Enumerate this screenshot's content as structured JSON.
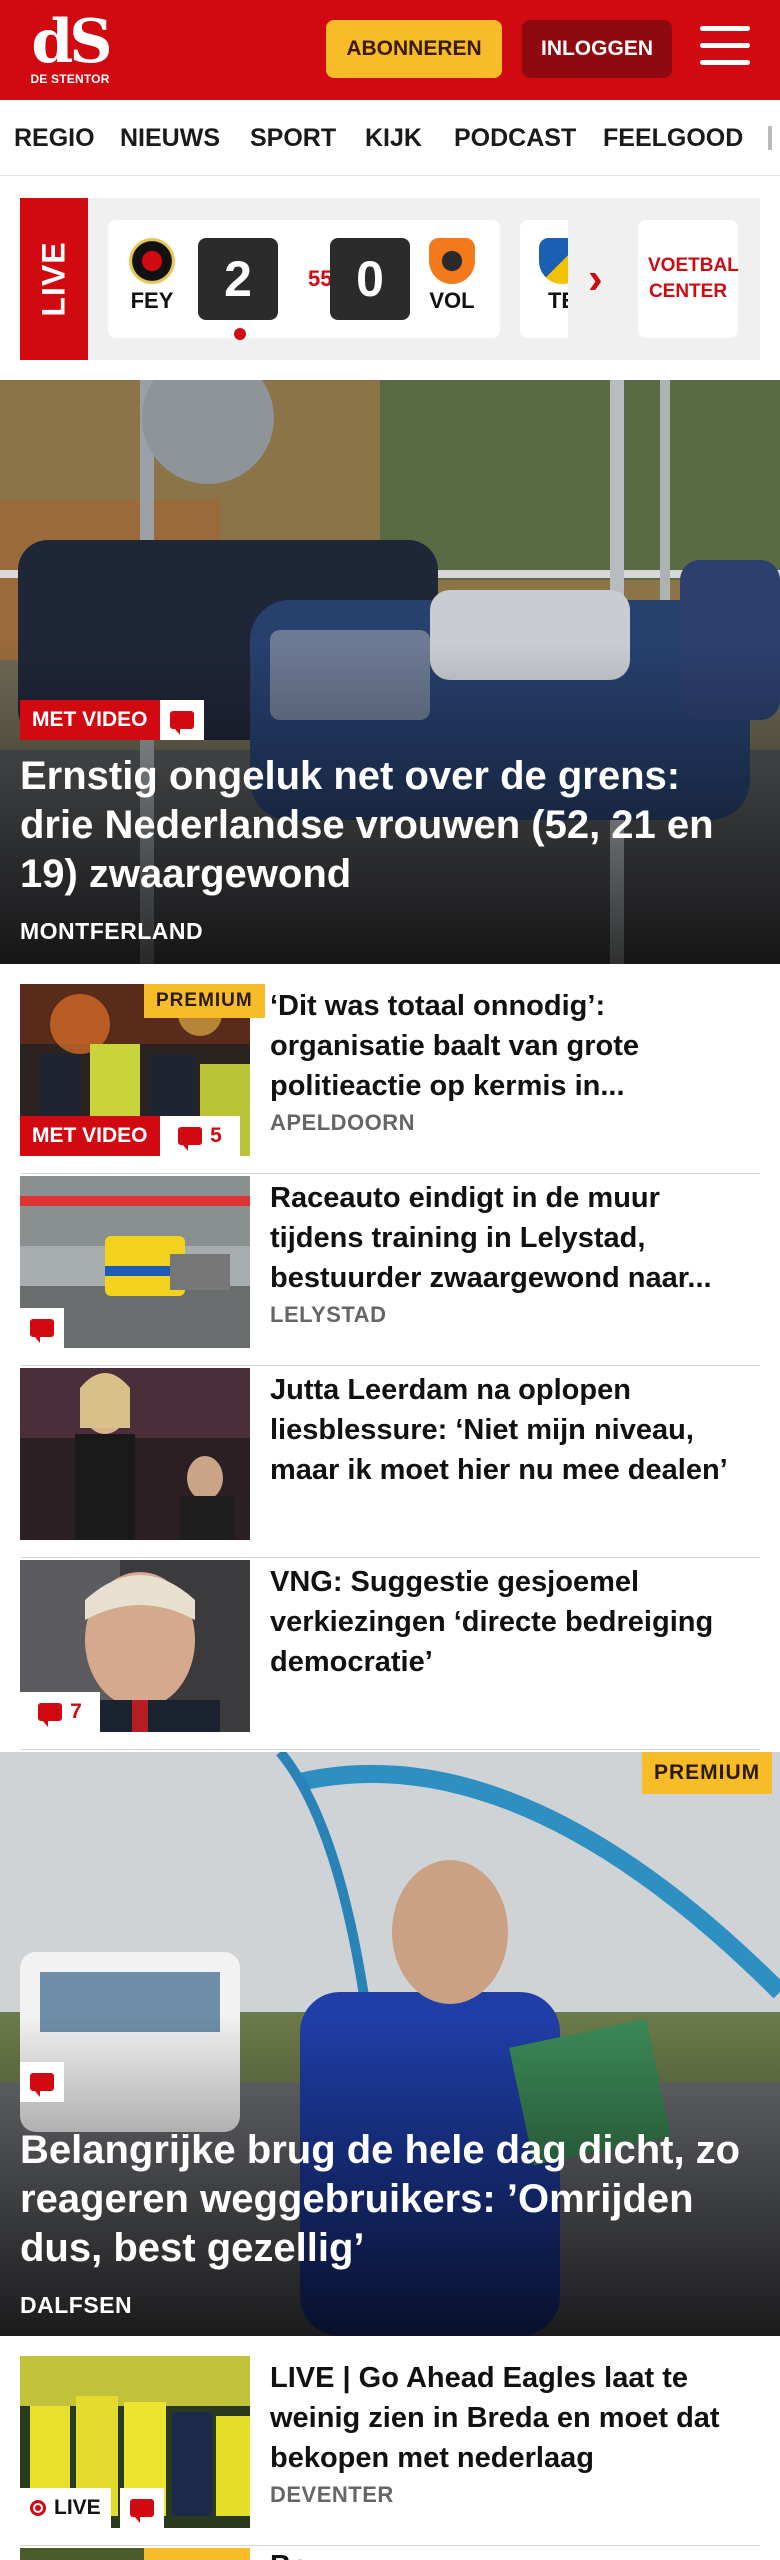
{
  "header": {
    "logo_mark": "dS",
    "logo_sub": "DE STENTOR",
    "subscribe_label": "ABONNEREN",
    "login_label": "INLOGGEN"
  },
  "nav": {
    "items": [
      "REGIO",
      "NIEUWS",
      "SPORT",
      "KIJK",
      "PODCAST",
      "FEELGOOD"
    ]
  },
  "live": {
    "tag": "LIVE",
    "match": {
      "home": "FEY",
      "away": "VOL",
      "home_score": "2",
      "away_score": "0",
      "minute": "55'"
    },
    "next_match_abbr": "TE",
    "voetbal_center": "VOETBAL CENTER"
  },
  "hero1": {
    "badge": "MET VIDEO",
    "title": "Ernstig ongeluk net over de grens: drie Nederlandse vrouwen (52, 21 en 19) zwaargewond",
    "location": "MONTFERLAND"
  },
  "articles": [
    {
      "premium": "PREMIUM",
      "badge": "MET VIDEO",
      "comments": "5",
      "title": "‘Dit was totaal onnodig’: organisatie baalt van grote politieactie op kermis in...",
      "location": "APELDOORN"
    },
    {
      "title": "Raceauto eindigt in de muur tijdens training in Lelystad, bestuurder zwaargewond naar...",
      "location": "LELYSTAD"
    },
    {
      "title": "Jutta Leerdam na oplopen liesblessure: ‘Niet mijn niveau, maar ik moet hier nu mee dealen’",
      "location": ""
    },
    {
      "comments": "7",
      "title": "VNG: Suggestie gesjoemel verkiezingen ‘directe bedreiging democratie’",
      "location": ""
    }
  ],
  "hero2": {
    "premium": "PREMIUM",
    "title": "Belangrijke brug de hele dag dicht, zo reageren weggebruikers: ’Omrijden dus, best gezellig’",
    "location": "DALFSEN"
  },
  "article_live": {
    "live_label": "LIVE",
    "title": "LIVE | Go Ahead Eagles laat te weinig zien in Breda en moet dat bekopen met nederlaag",
    "location": "DEVENTER"
  },
  "next_article": {
    "premium": "PREMIUM",
    "title": "Bo..."
  }
}
